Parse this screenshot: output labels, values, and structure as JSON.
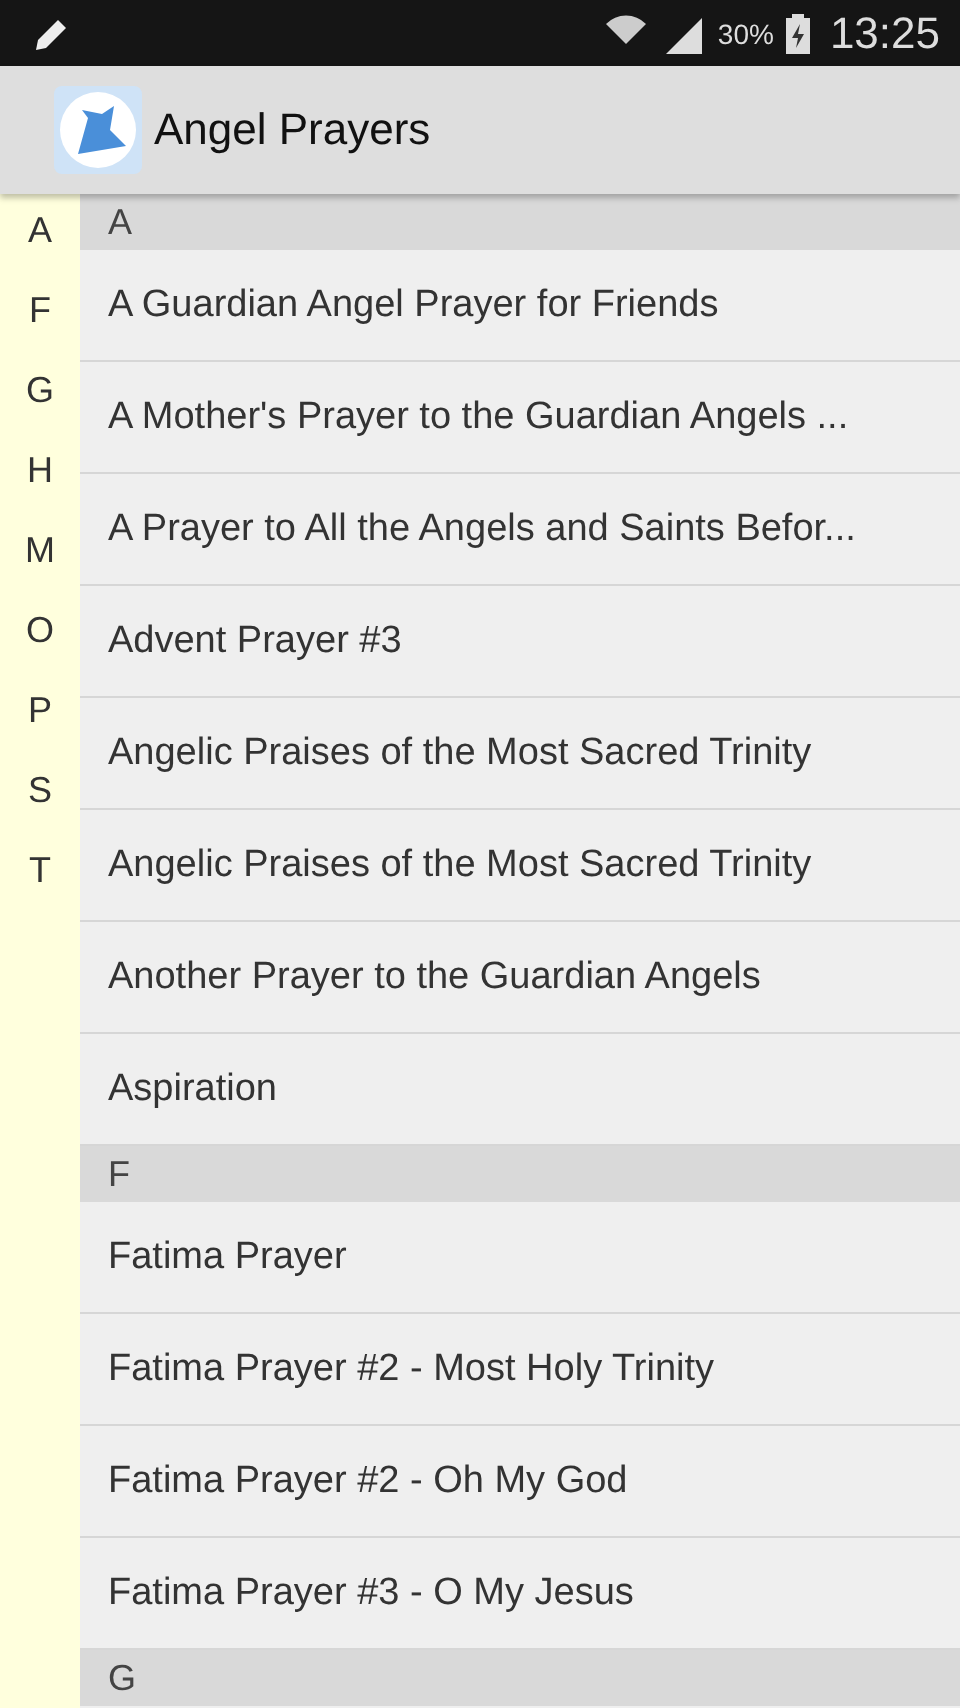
{
  "status_bar": {
    "battery": "30%",
    "time": "13:25"
  },
  "app_bar": {
    "title": "Angel Prayers"
  },
  "index": [
    "A",
    "F",
    "G",
    "H",
    "M",
    "O",
    "P",
    "S",
    "T"
  ],
  "sections": [
    {
      "header": "A",
      "items": [
        "A Guardian Angel Prayer for Friends",
        "A Mother's Prayer to the Guardian Angels ...",
        "A Prayer to All the Angels and Saints Befor...",
        "Advent Prayer #3",
        "Angelic Praises of the Most Sacred Trinity",
        "Angelic Praises of the Most Sacred Trinity",
        "Another Prayer to the Guardian Angels",
        "Aspiration"
      ]
    },
    {
      "header": "F",
      "items": [
        "Fatima Prayer",
        "Fatima Prayer #2 - Most Holy Trinity",
        "Fatima Prayer #2 - Oh My God",
        "Fatima Prayer #3 - O My Jesus"
      ]
    },
    {
      "header": "G"
    }
  ]
}
